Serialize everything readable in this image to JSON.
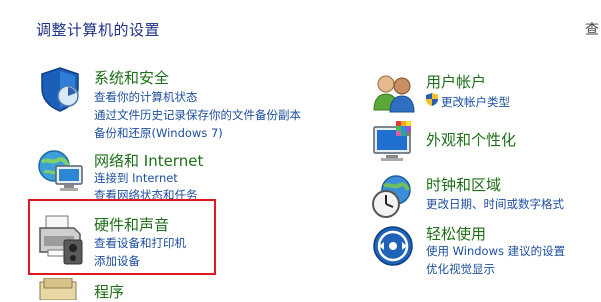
{
  "page_title": "调整计算机的设置",
  "view_by_label": "查",
  "left_categories": [
    {
      "title": "系统和安全",
      "links": [
        "查看你的计算机状态",
        "通过文件历史记录保存你的文件备份副本",
        "备份和还原(Windows 7)"
      ]
    },
    {
      "title": "网络和 Internet",
      "links": [
        "连接到 Internet",
        "查看网络状态和任务"
      ]
    },
    {
      "title": "硬件和声音",
      "links": [
        "查看设备和打印机",
        "添加设备"
      ]
    },
    {
      "title": "程序",
      "links": []
    }
  ],
  "right_categories": [
    {
      "title": "用户帐户",
      "links": [
        "更改帐户类型"
      ]
    },
    {
      "title": "外观和个性化",
      "links": []
    },
    {
      "title": "时钟和区域",
      "links": [
        "更改日期、时间或数字格式"
      ]
    },
    {
      "title": "轻松使用",
      "links": [
        "使用 Windows 建议的设置",
        "优化视觉显示"
      ]
    }
  ],
  "colors": {
    "title": "#1e3287",
    "category_heading": "#1e6e17",
    "link": "#1e4fa0",
    "highlight": "#e0181f"
  }
}
